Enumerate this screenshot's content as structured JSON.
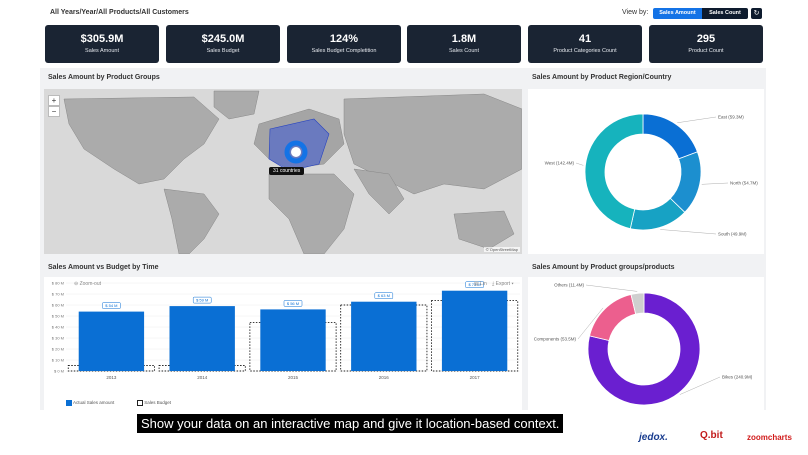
{
  "header": {
    "breadcrumb": "All Years/Year/All Products/All Customers",
    "view_by_label": "View by:",
    "view_sales_amount": "Sales Amount",
    "view_sales_count": "Sales Count",
    "refresh_icon": "refresh-icon"
  },
  "kpis": [
    {
      "value": "$305.9M",
      "label": "Sales Amount"
    },
    {
      "value": "$245.0M",
      "label": "Sales Budget"
    },
    {
      "value": "124%",
      "label": "Sales Budget Completition"
    },
    {
      "value": "1.8M",
      "label": "Sales Count"
    },
    {
      "value": "41",
      "label": "Product Categories Count"
    },
    {
      "value": "295",
      "label": "Product Count"
    }
  ],
  "map_panel": {
    "title": "Sales Amount by Product Groups",
    "zoom_in": "+",
    "zoom_out": "−",
    "cluster_label": "31 countries",
    "attribution": "© OpenStreetMap"
  },
  "region_panel": {
    "title": "Sales Amount by Product Region/Country"
  },
  "time_panel": {
    "title": "Sales Amount vs Budget by Time",
    "zoom_out": "Zoom-out",
    "lin": "Lin",
    "export": "Export"
  },
  "groups_panel": {
    "title": "Sales Amount by Product groups/products"
  },
  "chart_data": [
    {
      "type": "pie",
      "title": "Sales Amount by Product Region/Country",
      "donut": true,
      "slices": [
        {
          "label": "East (59.3M)",
          "value": 59.3,
          "color": "#0a6fd4"
        },
        {
          "label": "North (54.7M)",
          "value": 54.7,
          "color": "#1c8fcf"
        },
        {
          "label": "South (49.9M)",
          "value": 49.9,
          "color": "#17a2c4"
        },
        {
          "label": "West (142.4M)",
          "value": 142.4,
          "color": "#16b3bd"
        }
      ]
    },
    {
      "type": "bar",
      "title": "Sales Amount vs Budget by Time",
      "categories": [
        "2013",
        "2014",
        "2015",
        "2016",
        "2017"
      ],
      "series": [
        {
          "name": "Actual Sales amount",
          "values": [
            54,
            59,
            56,
            63,
            73
          ],
          "labels": [
            "$ 54 M",
            "$ 59 M",
            "$ 56 M",
            "$ 63 M",
            "$ 73 M"
          ],
          "color": "#0a6fd4"
        },
        {
          "name": "Sales Budget",
          "values": [
            5,
            5,
            44,
            60,
            64
          ],
          "color": "#222222"
        }
      ],
      "y_ticks": [
        "$ 0 M",
        "$ 10 M",
        "$ 20 M",
        "$ 30 M",
        "$ 40 M",
        "$ 50 M",
        "$ 60 M",
        "$ 70 M",
        "$ 80 M"
      ],
      "ylim": [
        0,
        80
      ]
    },
    {
      "type": "pie",
      "title": "Sales Amount by Product groups/products",
      "donut": true,
      "slices": [
        {
          "label": "Bikes (240.9M)",
          "value": 240.9,
          "color": "#6a1fd0"
        },
        {
          "label": "Components (53.5M)",
          "value": 53.5,
          "color": "#ec5f8e"
        },
        {
          "label": "Others (11.4M)",
          "value": 11.4,
          "color": "#cfcfcf"
        }
      ]
    }
  ],
  "caption": "Show your data on an interactive map and give it location-based context.",
  "brands": {
    "jedox": "jedox.",
    "qbit": "Q.bit",
    "zoomcharts": "zoomcharts"
  }
}
